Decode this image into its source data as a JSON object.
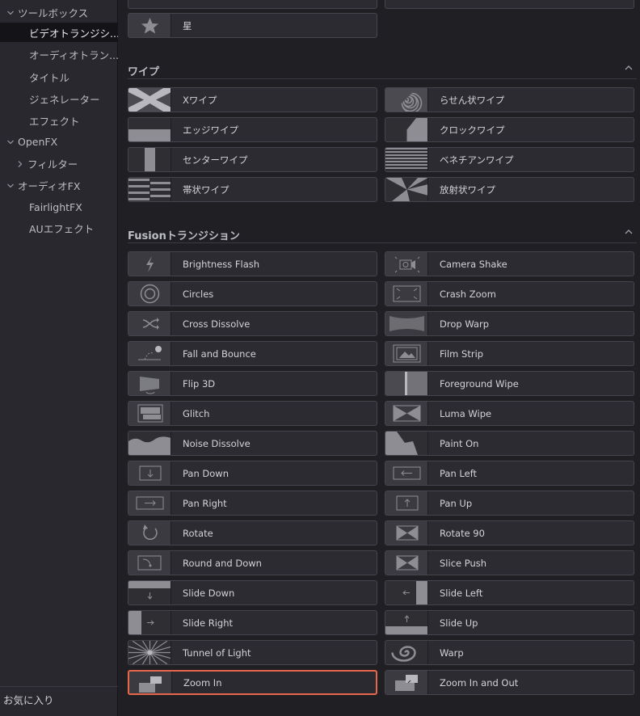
{
  "sidebar": {
    "items": [
      {
        "label": "ツールボックス",
        "chevron": "down",
        "indent": 0
      },
      {
        "label": "ビデオトランジシ...",
        "chevron": "",
        "indent": 1,
        "selected": true
      },
      {
        "label": "オーディオトラン...",
        "chevron": "",
        "indent": 1
      },
      {
        "label": "タイトル",
        "chevron": "",
        "indent": 1
      },
      {
        "label": "ジェネレーター",
        "chevron": "",
        "indent": 1
      },
      {
        "label": "エフェクト",
        "chevron": "",
        "indent": 1
      },
      {
        "label": "OpenFX",
        "chevron": "down",
        "indent": 0
      },
      {
        "label": "フィルター",
        "chevron": "right",
        "indent": 1
      },
      {
        "label": "オーディオFX",
        "chevron": "down",
        "indent": 0
      },
      {
        "label": "FairlightFX",
        "chevron": "",
        "indent": 1
      },
      {
        "label": "AUエフェクト",
        "chevron": "",
        "indent": 1
      }
    ],
    "favorites_label": "お気に入り"
  },
  "main": {
    "top_partial": {
      "star_label": "星",
      "star_icon": "star-icon"
    },
    "sections": [
      {
        "title": "ワイプ",
        "items": [
          {
            "label": "Xワイプ",
            "icon": "x-wipe"
          },
          {
            "label": "らせん状ワイプ",
            "icon": "spiral-wipe"
          },
          {
            "label": "エッジワイプ",
            "icon": "edge-wipe"
          },
          {
            "label": "クロックワイプ",
            "icon": "clock-wipe"
          },
          {
            "label": "センターワイプ",
            "icon": "center-wipe"
          },
          {
            "label": "ベネチアンワイプ",
            "icon": "venetian-wipe"
          },
          {
            "label": "帯状ワイプ",
            "icon": "band-wipe"
          },
          {
            "label": "放射状ワイプ",
            "icon": "radial-wipe"
          }
        ]
      },
      {
        "title": "Fusionトランジション",
        "items": [
          {
            "label": "Brightness Flash",
            "icon": "flash"
          },
          {
            "label": "Camera Shake",
            "icon": "camera"
          },
          {
            "label": "Circles",
            "icon": "circles"
          },
          {
            "label": "Crash Zoom",
            "icon": "crash-zoom"
          },
          {
            "label": "Cross Dissolve",
            "icon": "cross-dissolve"
          },
          {
            "label": "Drop Warp",
            "icon": "drop-warp"
          },
          {
            "label": "Fall and Bounce",
            "icon": "fall-bounce"
          },
          {
            "label": "Film Strip",
            "icon": "film-strip"
          },
          {
            "label": "Flip 3D",
            "icon": "flip-3d"
          },
          {
            "label": "Foreground Wipe",
            "icon": "foreground-wipe"
          },
          {
            "label": "Glitch",
            "icon": "glitch"
          },
          {
            "label": "Luma Wipe",
            "icon": "luma-wipe"
          },
          {
            "label": "Noise Dissolve",
            "icon": "noise-dissolve"
          },
          {
            "label": "Paint On",
            "icon": "paint-on"
          },
          {
            "label": "Pan Down",
            "icon": "pan-down"
          },
          {
            "label": "Pan Left",
            "icon": "pan-left"
          },
          {
            "label": "Pan Right",
            "icon": "pan-right"
          },
          {
            "label": "Pan Up",
            "icon": "pan-up"
          },
          {
            "label": "Rotate",
            "icon": "rotate"
          },
          {
            "label": "Rotate 90",
            "icon": "rotate-90"
          },
          {
            "label": "Round and Down",
            "icon": "round-down"
          },
          {
            "label": "Slice Push",
            "icon": "slice-push"
          },
          {
            "label": "Slide Down",
            "icon": "slide-down"
          },
          {
            "label": "Slide Left",
            "icon": "slide-left"
          },
          {
            "label": "Slide Right",
            "icon": "slide-right"
          },
          {
            "label": "Slide Up",
            "icon": "slide-up"
          },
          {
            "label": "Tunnel of Light",
            "icon": "tunnel"
          },
          {
            "label": "Warp",
            "icon": "warp"
          },
          {
            "label": "Zoom In",
            "icon": "zoom-in",
            "selected": true
          },
          {
            "label": "Zoom In and Out",
            "icon": "zoom-in-out"
          }
        ]
      }
    ]
  },
  "colors": {
    "selection_border": "#e8674a",
    "background": "#1f1f24",
    "tile": "#2b2b31"
  }
}
